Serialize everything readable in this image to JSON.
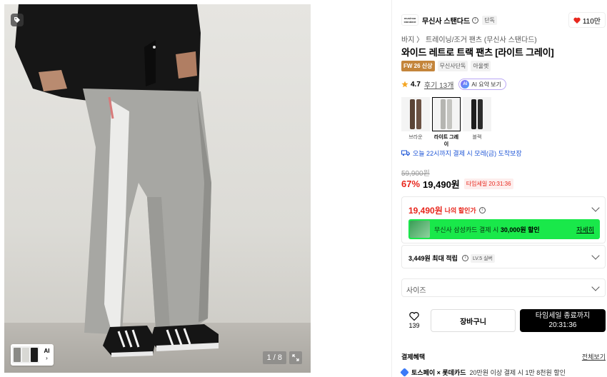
{
  "gallery": {
    "page_indicator": "1 / 8",
    "thumb_label": "AI"
  },
  "brand": {
    "logo_text": "musinsa standard",
    "name": "무신사 스탠다드",
    "exclusive_badge": "단독",
    "likes": "110만"
  },
  "product": {
    "breadcrumb": "바지 〉 트레이닝/조거 팬츠 (무신사 스탠다드)",
    "title": "와이드 레트로 트랙 팬츠 [라이트 그레이]",
    "badges": [
      "FW 26 신상",
      "무신사단독",
      "아울렛"
    ],
    "rating": "4.7",
    "reviews": "후기 13개",
    "ai_summary": "AI 요약 보기",
    "ai_icon": "AI"
  },
  "swatches": [
    {
      "label": "브라운",
      "selected": false
    },
    {
      "label": "라이트 그레이",
      "selected": true
    },
    {
      "label": "블랙",
      "selected": false
    }
  ],
  "delivery": "오늘 22시까지 결제 시 모레(금) 도착보장",
  "price": {
    "original": "59,900원",
    "discount": "67%",
    "current": "19,490원",
    "timesale": "타임세일 20:31:36"
  },
  "my_discount": {
    "price": "19,490원",
    "label": "나의 할인가"
  },
  "promo": {
    "text_prefix": "무신사 삼성카드 결제 시 ",
    "text_bold": "30,000원 할인",
    "more": "자세히"
  },
  "points": {
    "amount": "3,449원 최대 적립",
    "level": "LV.5 실버"
  },
  "size_placeholder": "사이즈",
  "actions": {
    "like_count": "139",
    "cart": "장바구니",
    "buy_line1": "타임세일 종료까지",
    "buy_line2": "20:31:36"
  },
  "benefits": {
    "heading": "결제혜택",
    "view_all": "전체보기",
    "pay_brand": "토스페이 × 롯데카드",
    "pay_desc": "20만원 이상 결제 시 1만 8천원 할인"
  },
  "colors": {
    "discount_red": "#e8271d",
    "promo_green": "#19e84a",
    "delivery_blue": "#1e55d6",
    "new_badge": "#c4853b"
  }
}
